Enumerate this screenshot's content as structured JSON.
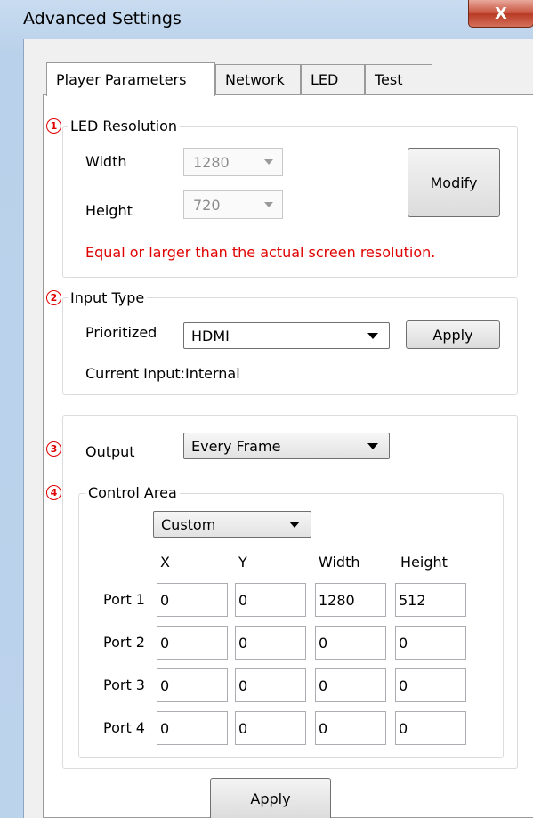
{
  "window": {
    "title": "Advanced Settings",
    "close_glyph": "X"
  },
  "tabs": [
    {
      "label": "Player Parameters",
      "active": true
    },
    {
      "label": "Network"
    },
    {
      "label": "LED"
    },
    {
      "label": "Test"
    }
  ],
  "resolution": {
    "marker": "1",
    "title": "LED Resolution",
    "width_label": "Width",
    "width_value": "1280",
    "height_label": "Height",
    "height_value": "720",
    "modify_label": "Modify",
    "warning": "Equal or larger than the actual screen resolution."
  },
  "input_type": {
    "marker": "2",
    "title": "Input Type",
    "prioritized_label": "Prioritized",
    "prioritized_value": "HDMI",
    "apply_label": "Apply",
    "current_input": "Current Input:Internal"
  },
  "output": {
    "marker": "3",
    "label": "Output",
    "value": "Every Frame"
  },
  "control_area": {
    "marker": "4",
    "title": "Control Area",
    "mode_value": "Custom",
    "columns": [
      "X",
      "Y",
      "Width",
      "Height"
    ],
    "ports": [
      {
        "label": "Port 1",
        "values": [
          "0",
          "0",
          "1280",
          "512"
        ]
      },
      {
        "label": "Port 2",
        "values": [
          "0",
          "0",
          "0",
          "0"
        ]
      },
      {
        "label": "Port 3",
        "values": [
          "0",
          "0",
          "0",
          "0"
        ]
      },
      {
        "label": "Port 4",
        "values": [
          "0",
          "0",
          "0",
          "0"
        ]
      }
    ]
  },
  "bottom_apply_label": "Apply",
  "colors": {
    "warning": "#e00000",
    "title_bar": "#bcd3ec",
    "close_button": "#c7513d"
  }
}
